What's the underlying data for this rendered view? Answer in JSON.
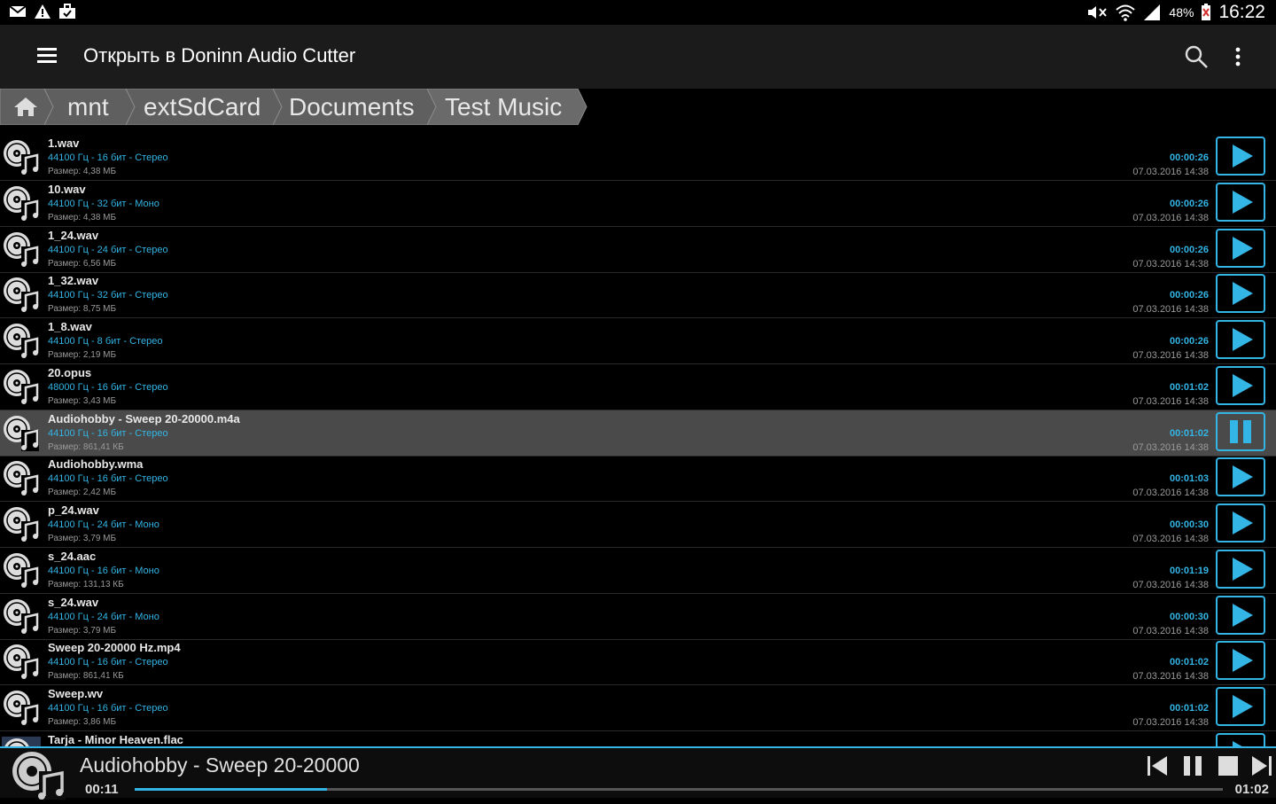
{
  "status_bar": {
    "battery": "48%",
    "time": "16:22",
    "left_icons": [
      "mail-icon",
      "warning-icon",
      "briefcase-icon"
    ],
    "right_icons": [
      "mute-icon",
      "wifi-icon",
      "signal-icon",
      "battery-icon"
    ]
  },
  "toolbar": {
    "title": "Открыть в Doninn Audio Cutter",
    "menu_icon": "hamburger-menu-icon",
    "search_icon": "search-icon",
    "more_icon": "more-vertical-icon"
  },
  "breadcrumb": {
    "home_icon": "home-icon",
    "items": [
      "mnt",
      "extSdCard",
      "Documents",
      "Test Music"
    ]
  },
  "files": [
    {
      "name": "1.wav",
      "info": "44100 Гц - 16 бит - Стерео",
      "size": "Размер: 4,38 МБ",
      "duration": "00:00:26",
      "date": "07.03.2016 14:38",
      "state": "play"
    },
    {
      "name": "10.wav",
      "info": "44100 Гц - 32 бит - Моно",
      "size": "Размер: 4,38 МБ",
      "duration": "00:00:26",
      "date": "07.03.2016 14:38",
      "state": "play"
    },
    {
      "name": "1_24.wav",
      "info": "44100 Гц - 24 бит - Стерео",
      "size": "Размер: 6,56 МБ",
      "duration": "00:00:26",
      "date": "07.03.2016 14:38",
      "state": "play"
    },
    {
      "name": "1_32.wav",
      "info": "44100 Гц - 32 бит - Стерео",
      "size": "Размер: 8,75 МБ",
      "duration": "00:00:26",
      "date": "07.03.2016 14:38",
      "state": "play"
    },
    {
      "name": "1_8.wav",
      "info": "44100 Гц - 8 бит - Стерео",
      "size": "Размер: 2,19 МБ",
      "duration": "00:00:26",
      "date": "07.03.2016 14:38",
      "state": "play"
    },
    {
      "name": "20.opus",
      "info": "48000 Гц - 16 бит - Стерео",
      "size": "Размер: 3,43 МБ",
      "duration": "00:01:02",
      "date": "07.03.2016 14:38",
      "state": "play"
    },
    {
      "name": "Audiohobby - Sweep 20-20000.m4a",
      "info": "44100 Гц - 16 бит - Стерео",
      "size": "Размер: 861,41 КБ",
      "duration": "00:01:02",
      "date": "07.03.2016 14:38",
      "state": "pause"
    },
    {
      "name": "Audiohobby.wma",
      "info": "44100 Гц - 16 бит - Стерео",
      "size": "Размер: 2,42 МБ",
      "duration": "00:01:03",
      "date": "07.03.2016 14:38",
      "state": "play"
    },
    {
      "name": "p_24.wav",
      "info": "44100 Гц - 24 бит - Моно",
      "size": "Размер: 3,79 МБ",
      "duration": "00:00:30",
      "date": "07.03.2016 14:38",
      "state": "play"
    },
    {
      "name": "s_24.aac",
      "info": "44100 Гц - 16 бит - Моно",
      "size": "Размер: 131,13 КБ",
      "duration": "00:01:19",
      "date": "07.03.2016 14:38",
      "state": "play"
    },
    {
      "name": "s_24.wav",
      "info": "44100 Гц - 24 бит - Моно",
      "size": "Размер: 3,79 МБ",
      "duration": "00:00:30",
      "date": "07.03.2016 14:38",
      "state": "play"
    },
    {
      "name": "Sweep 20-20000 Hz.mp4",
      "info": "44100 Гц - 16 бит - Стерео",
      "size": "Размер: 861,41 КБ",
      "duration": "00:01:02",
      "date": "07.03.2016 14:38",
      "state": "play"
    },
    {
      "name": "Sweep.wv",
      "info": "44100 Гц - 16 бит - Стерео",
      "size": "Размер: 3,86 МБ",
      "duration": "00:01:02",
      "date": "07.03.2016 14:38",
      "state": "play"
    },
    {
      "name": "Tarja - Minor Heaven.flac",
      "info": "",
      "size": "",
      "duration": "",
      "date": "",
      "state": "play",
      "partial": true
    }
  ],
  "player": {
    "title": "Audiohobby - Sweep 20-20000",
    "elapsed": "00:11",
    "total": "01:02",
    "progress": 0.177,
    "controls": [
      "skip-previous-icon",
      "pause-icon",
      "stop-icon",
      "skip-next-icon"
    ]
  },
  "colors": {
    "accent": "#33b5e5",
    "toolbar": "#1b1b1b",
    "active_row": "#4a4a4a"
  }
}
